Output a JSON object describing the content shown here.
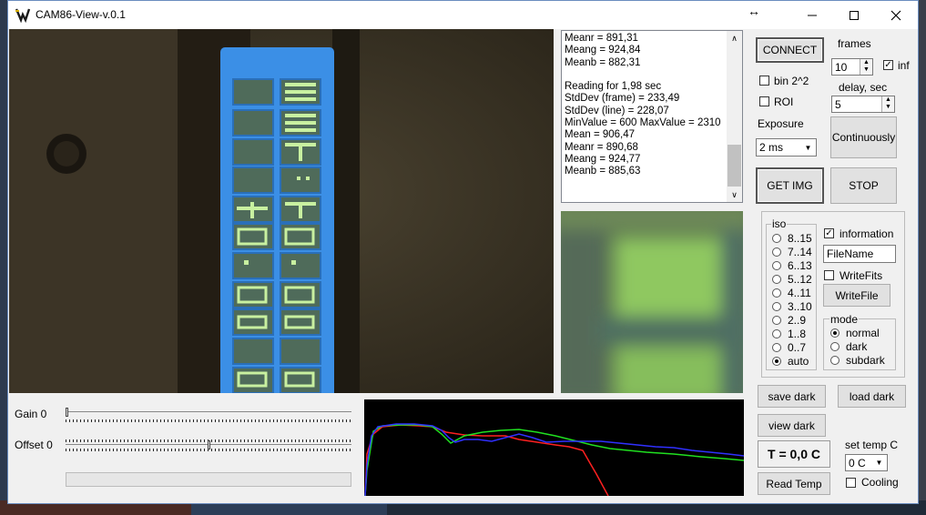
{
  "window": {
    "title": "CAM86-View-v.0.1"
  },
  "log": {
    "lines": [
      "Meanr = 891,31",
      "Meang = 924,84",
      "Meanb = 882,31",
      "",
      "Reading for 1,98 sec",
      "StdDev (frame) = 233,49",
      "StdDev (line) = 228,07",
      "MinValue = 600 MaxValue = 2310",
      "Mean = 906,47",
      "Meanr = 890,68",
      "Meang = 924,77",
      "Meanb = 885,63"
    ]
  },
  "controls": {
    "connect": "CONNECT",
    "frames_label": "frames",
    "frames_value": "10",
    "inf_label": "inf",
    "bin_label": "bin 2^2",
    "roi_label": "ROI",
    "delay_label": "delay, sec",
    "delay_value": "5",
    "exposure_label": "Exposure",
    "exposure_value": "2 ms",
    "continuously": "Continuously",
    "get_img": "GET IMG",
    "stop": "STOP"
  },
  "iso": {
    "label": "iso",
    "options": [
      "8..15",
      "7..14",
      "6..13",
      "5..12",
      "4..11",
      "3..10",
      "2..9",
      "1..8",
      "0..7",
      "auto"
    ],
    "selected": "auto"
  },
  "info": {
    "information_label": "information",
    "filename_value": "FileName",
    "writefits_label": "WriteFits",
    "writefile": "WriteFile"
  },
  "mode": {
    "label": "mode",
    "options": [
      "normal",
      "dark",
      "subdark"
    ],
    "selected": "normal"
  },
  "dark": {
    "save": "save dark",
    "load": "load dark",
    "view": "view dark"
  },
  "temp": {
    "display": "T = 0,0 C",
    "set_label": "set temp C",
    "set_value": "0 C",
    "read": "Read Temp",
    "cooling_label": "Cooling"
  },
  "sliders": {
    "gain_label": "Gain 0",
    "gain_value": 0,
    "offset_label": "Offset 0",
    "offset_value": 0.5
  },
  "colors": {
    "histogram_bg": "#000000",
    "red": "#ff2020",
    "green": "#20e020",
    "blue": "#3030ff",
    "lcd_blue": "#3b8fe6"
  }
}
